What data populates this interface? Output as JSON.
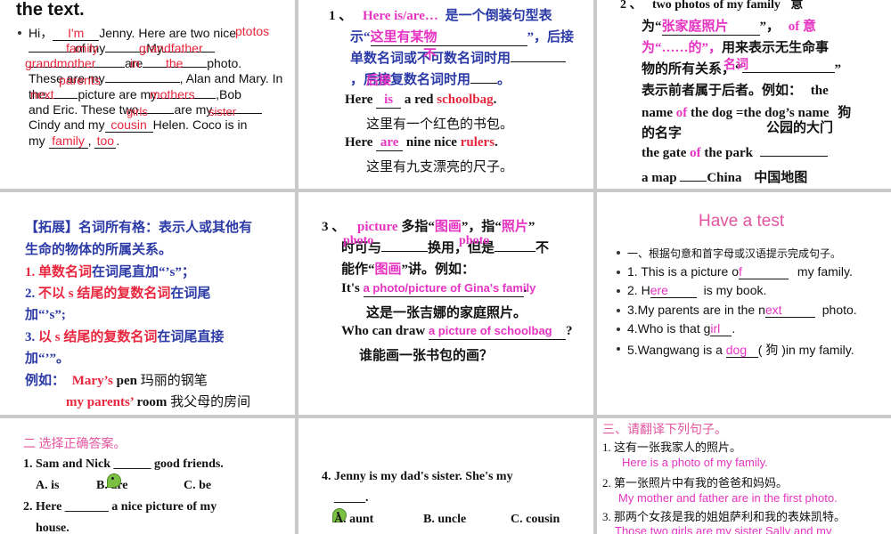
{
  "s1": {
    "title": "the text.",
    "l1a": "Hi，",
    "l1_blank": "I'm",
    "l1b": "Jenny. Here are two nice",
    "l1_ptotos": "ptotos",
    "l2_family": "family",
    "l2a": "of my",
    "l2_grand": "grandfather",
    "l2_my": "My",
    "l3_grandmother": "grandmother",
    "l3a": "are",
    "l3_in": "in",
    "l3_the": "the",
    "l3b": "photo.",
    "l4a": "These are my",
    "l4_parents": "parents",
    "l4b": ", Alan and Mary. In",
    "l5_next": "next",
    "l5a": "the",
    "l5b": "picture are my",
    "l5_mothers": "mothers",
    "l5c": ",Bob",
    "l6a": "and Eric. These two",
    "l6_girls": "girls",
    "l6b": "are my",
    "l6_sister": "sister",
    "l7a": "Cindy and my",
    "l7_cousin": "cousin",
    "l7b": "Helen. Coco is in",
    "l8a": "my",
    "l8_family": "family",
    "l8_sep": ",",
    "l8_too": "too",
    "l8_end": "."
  },
  "s2": {
    "num": "1 、",
    "h1": "Here is/are…",
    "h1b": "是一个倒装句型表",
    "h2a": "示“",
    "h2_ans": "这里有某物",
    "h2b": "”，后接",
    "h3a": "单数名词或不可数名词时用",
    "h3_ans": "不",
    "h4a": "，后接复数名词时用",
    "h4_ans": "后接",
    "h4b": "。",
    "e1a": "Here",
    "e1_ans": "is",
    "e1b": "a red",
    "e1_word": "schoolbag",
    "e1c": ".",
    "e1cn": "这里有一个红色的书包。",
    "e2a": "Here",
    "e2_ans": "are",
    "e2b": "nine nice",
    "e2_word": "rulers",
    "e2c": ".",
    "e2cn": "这里有九支漂亮的尺子。"
  },
  "s3": {
    "num": "2 、",
    "h1": "two photos of my family",
    "h1b": "意",
    "h2a": "为“",
    "h2_ans": "张家庭照片",
    "h2b": "”，",
    "h2c": "of 意",
    "h3a": "为“……的”，",
    "h3b": "用来表示无生命事",
    "h4a": "物的所有关系，“",
    "h4_ans": "名词",
    "h4b": "”",
    "h5a": "表示前者属于后者。例如：",
    "h5b": "the",
    "h6a": "name",
    "h6b": "of",
    "h6c": "the dog =the dog’s name",
    "h6d": "狗",
    "h7a": "的名字",
    "h7b": "公园的大门",
    "h8a": "the gate",
    "h8_ans": "of",
    "h8b": "the park",
    "h9a": "a map",
    "h9b": "China",
    "h9c": "中国地图"
  },
  "s4": {
    "t1": "【拓展】名词所有格：表示人或其他有",
    "t2": "生命的物体的所属关系。",
    "r1a": "1. 单数名词",
    "r1b": "在词尾直加“’s”；",
    "r2a": "2.",
    "r2b": "不以 s 结尾的复数名词",
    "r2c": "在词尾",
    "r2d": "加“’s”;",
    "r3a": "3.",
    "r3b": "以 s 结尾的复数名词",
    "r3c": "在词尾直接",
    "r3d": "加“’”。",
    "ex_label": "例如：",
    "ex1a": "Mary’s",
    "ex1b": "pen",
    "ex1c": "玛丽的钢笔",
    "ex2a": "my parents’",
    "ex2b": "room",
    "ex2c": "我父母的房间"
  },
  "s5": {
    "num": "3 、",
    "h1": "picture",
    "h1b": "多指“",
    "h1c": "图画",
    "h1d": "”，指“",
    "h1e": "照片",
    "h1f": "”",
    "h2_ans1": "photo",
    "h2_ans2": "photo",
    "h2a": "时可与",
    "h2b": "换用，但是",
    "h2c": "不",
    "h3a": "能作“",
    "h3b": "图画",
    "h3c": "”讲。例如：",
    "e1a": "It's",
    "e1_ans": "a photo/picture of Gina's family",
    "e1b": ".",
    "e1cn": "这是一张吉娜的家庭照片。",
    "e2a": "Who can draw",
    "e2_ans": "a picture of schoolbag",
    "e2b": "?",
    "e2cn": "谁能画一张书包的画？"
  },
  "s6": {
    "title": "Have a test",
    "i0": "一、根据句意和首字母或汉语提示完成句子。",
    "i1a": "1. This is a picture o",
    "i1_ans": "f",
    "i1b": "my family.",
    "i2a": "2. H",
    "i2_ans": "ere",
    "i2b": "is my book.",
    "i3a": "3.My parents are in the n",
    "i3_ans": "ext",
    "i3b": "photo.",
    "i4a": "4.Who is that g",
    "i4_ans": "irl",
    "i4b": ".",
    "i5a": "5.Wangwang is a",
    "i5_ans": "dog",
    "i5b": "( 狗 )in my family."
  },
  "s7": {
    "title": "二 选择正确答案。",
    "q1": "1. Sam and Nick ______ good friends.",
    "q1a": "A. is",
    "q1b": "B. are",
    "q1c": "C. be",
    "q2a": "2. Here _______ a nice picture of my",
    "q2b": "house."
  },
  "s8": {
    "q4a": "4. Jenny is my dad's sister. She's my",
    "q4b": "_____.",
    "oa": "A. aunt",
    "ob": "B. uncle",
    "oc": "C. cousin"
  },
  "s9": {
    "title": "三、请翻译下列句子。",
    "q1": "1.   这有一张我家人的照片。",
    "a1": "Here is a photo of my family.",
    "q2": "2.   第一张照片中有我的爸爸和妈妈。",
    "a2": "My mother and father are in the first photo.",
    "q3": "3. 那两个女孩是我的姐姐萨利和我的表妹凯特。",
    "a3": "Those two girls are my sister Sally and my"
  }
}
